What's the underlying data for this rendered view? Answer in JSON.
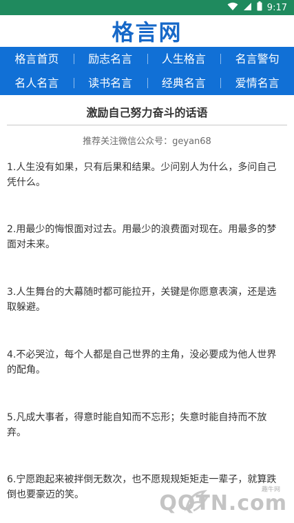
{
  "status_bar": {
    "time": "9:17",
    "icons": [
      "wifi-icon",
      "signal-icon",
      "battery-icon"
    ],
    "color": "#1f8a5e"
  },
  "site": {
    "logo": "格言网",
    "logo_color": "#1668c8"
  },
  "nav": {
    "color": "#1170d6",
    "rows": [
      [
        "格言首页",
        "励志名言",
        "人生格言",
        "名言警句"
      ],
      [
        "名人名言",
        "读书名言",
        "经典名言",
        "爱情名言"
      ]
    ]
  },
  "article": {
    "title": "激励自己努力奋斗的话语",
    "subscribe_note": "推荐关注微信公众号：geyan68",
    "quotes": [
      "1.人生没有如果，只有后果和结果。少问别人为什么，多问自己凭什么。",
      "2.用最少的悔恨面对过去。用最少的浪费面对现在。用最多的梦面对未来。",
      "3.人生舞台的大幕随时都可能拉开，关键是你愿意表演，还是选取躲避。",
      "4.不必哭泣，每个人都是自己世界的主角，没必要成为他人世界的配角。",
      "5.凡成大事者，得意时能自知而不忘形；失意时能自持而不放弃。",
      "6.宁愿跑起来被拌倒无数次，也不愿规规矩矩走一辈子，就算跌倒也要豪迈的笑。"
    ]
  },
  "watermark": {
    "small_text": "趣牛网",
    "text": "QQTN.com"
  }
}
